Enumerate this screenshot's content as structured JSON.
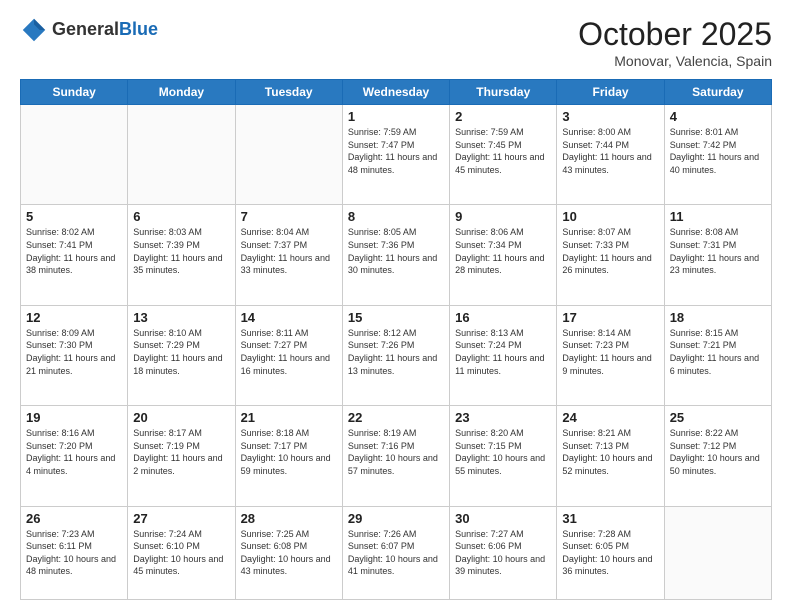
{
  "header": {
    "logo_general": "General",
    "logo_blue": "Blue",
    "month": "October 2025",
    "location": "Monovar, Valencia, Spain"
  },
  "weekdays": [
    "Sunday",
    "Monday",
    "Tuesday",
    "Wednesday",
    "Thursday",
    "Friday",
    "Saturday"
  ],
  "weeks": [
    [
      {
        "day": "",
        "info": ""
      },
      {
        "day": "",
        "info": ""
      },
      {
        "day": "",
        "info": ""
      },
      {
        "day": "1",
        "info": "Sunrise: 7:59 AM\nSunset: 7:47 PM\nDaylight: 11 hours and 48 minutes."
      },
      {
        "day": "2",
        "info": "Sunrise: 7:59 AM\nSunset: 7:45 PM\nDaylight: 11 hours and 45 minutes."
      },
      {
        "day": "3",
        "info": "Sunrise: 8:00 AM\nSunset: 7:44 PM\nDaylight: 11 hours and 43 minutes."
      },
      {
        "day": "4",
        "info": "Sunrise: 8:01 AM\nSunset: 7:42 PM\nDaylight: 11 hours and 40 minutes."
      }
    ],
    [
      {
        "day": "5",
        "info": "Sunrise: 8:02 AM\nSunset: 7:41 PM\nDaylight: 11 hours and 38 minutes."
      },
      {
        "day": "6",
        "info": "Sunrise: 8:03 AM\nSunset: 7:39 PM\nDaylight: 11 hours and 35 minutes."
      },
      {
        "day": "7",
        "info": "Sunrise: 8:04 AM\nSunset: 7:37 PM\nDaylight: 11 hours and 33 minutes."
      },
      {
        "day": "8",
        "info": "Sunrise: 8:05 AM\nSunset: 7:36 PM\nDaylight: 11 hours and 30 minutes."
      },
      {
        "day": "9",
        "info": "Sunrise: 8:06 AM\nSunset: 7:34 PM\nDaylight: 11 hours and 28 minutes."
      },
      {
        "day": "10",
        "info": "Sunrise: 8:07 AM\nSunset: 7:33 PM\nDaylight: 11 hours and 26 minutes."
      },
      {
        "day": "11",
        "info": "Sunrise: 8:08 AM\nSunset: 7:31 PM\nDaylight: 11 hours and 23 minutes."
      }
    ],
    [
      {
        "day": "12",
        "info": "Sunrise: 8:09 AM\nSunset: 7:30 PM\nDaylight: 11 hours and 21 minutes."
      },
      {
        "day": "13",
        "info": "Sunrise: 8:10 AM\nSunset: 7:29 PM\nDaylight: 11 hours and 18 minutes."
      },
      {
        "day": "14",
        "info": "Sunrise: 8:11 AM\nSunset: 7:27 PM\nDaylight: 11 hours and 16 minutes."
      },
      {
        "day": "15",
        "info": "Sunrise: 8:12 AM\nSunset: 7:26 PM\nDaylight: 11 hours and 13 minutes."
      },
      {
        "day": "16",
        "info": "Sunrise: 8:13 AM\nSunset: 7:24 PM\nDaylight: 11 hours and 11 minutes."
      },
      {
        "day": "17",
        "info": "Sunrise: 8:14 AM\nSunset: 7:23 PM\nDaylight: 11 hours and 9 minutes."
      },
      {
        "day": "18",
        "info": "Sunrise: 8:15 AM\nSunset: 7:21 PM\nDaylight: 11 hours and 6 minutes."
      }
    ],
    [
      {
        "day": "19",
        "info": "Sunrise: 8:16 AM\nSunset: 7:20 PM\nDaylight: 11 hours and 4 minutes."
      },
      {
        "day": "20",
        "info": "Sunrise: 8:17 AM\nSunset: 7:19 PM\nDaylight: 11 hours and 2 minutes."
      },
      {
        "day": "21",
        "info": "Sunrise: 8:18 AM\nSunset: 7:17 PM\nDaylight: 10 hours and 59 minutes."
      },
      {
        "day": "22",
        "info": "Sunrise: 8:19 AM\nSunset: 7:16 PM\nDaylight: 10 hours and 57 minutes."
      },
      {
        "day": "23",
        "info": "Sunrise: 8:20 AM\nSunset: 7:15 PM\nDaylight: 10 hours and 55 minutes."
      },
      {
        "day": "24",
        "info": "Sunrise: 8:21 AM\nSunset: 7:13 PM\nDaylight: 10 hours and 52 minutes."
      },
      {
        "day": "25",
        "info": "Sunrise: 8:22 AM\nSunset: 7:12 PM\nDaylight: 10 hours and 50 minutes."
      }
    ],
    [
      {
        "day": "26",
        "info": "Sunrise: 7:23 AM\nSunset: 6:11 PM\nDaylight: 10 hours and 48 minutes."
      },
      {
        "day": "27",
        "info": "Sunrise: 7:24 AM\nSunset: 6:10 PM\nDaylight: 10 hours and 45 minutes."
      },
      {
        "day": "28",
        "info": "Sunrise: 7:25 AM\nSunset: 6:08 PM\nDaylight: 10 hours and 43 minutes."
      },
      {
        "day": "29",
        "info": "Sunrise: 7:26 AM\nSunset: 6:07 PM\nDaylight: 10 hours and 41 minutes."
      },
      {
        "day": "30",
        "info": "Sunrise: 7:27 AM\nSunset: 6:06 PM\nDaylight: 10 hours and 39 minutes."
      },
      {
        "day": "31",
        "info": "Sunrise: 7:28 AM\nSunset: 6:05 PM\nDaylight: 10 hours and 36 minutes."
      },
      {
        "day": "",
        "info": ""
      }
    ]
  ]
}
